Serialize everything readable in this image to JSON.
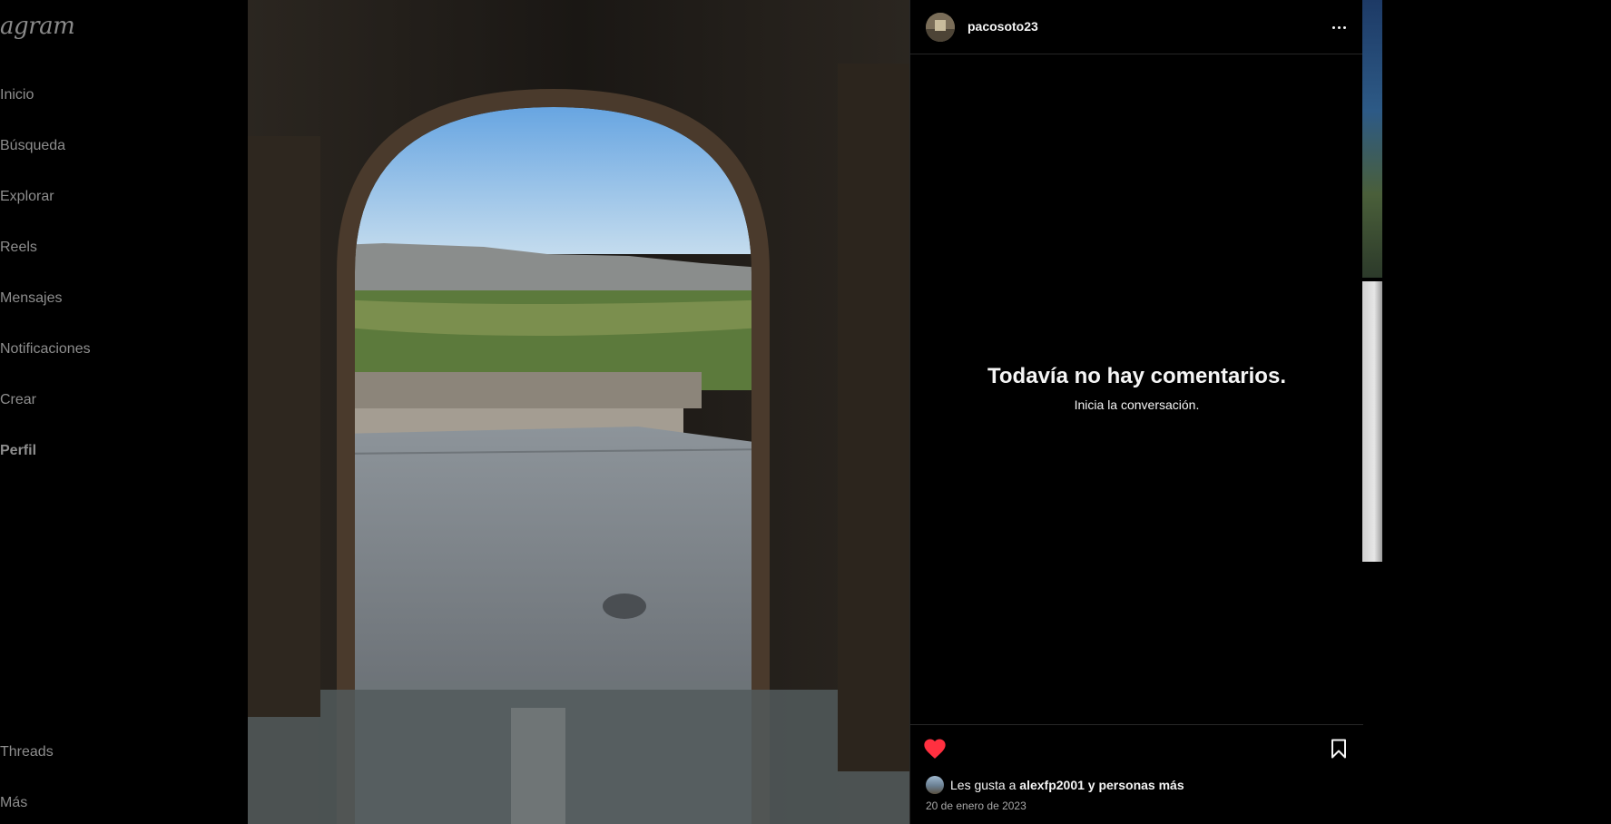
{
  "sidebar": {
    "logo": "agram",
    "items": [
      {
        "label": "Inicio"
      },
      {
        "label": "Búsqueda"
      },
      {
        "label": "Explorar"
      },
      {
        "label": "Reels"
      },
      {
        "label": "Mensajes"
      },
      {
        "label": "Notificaciones"
      },
      {
        "label": "Crear"
      },
      {
        "label": "Perfil"
      }
    ],
    "bottom_items": [
      {
        "label": "Threads"
      },
      {
        "label": "Más"
      }
    ]
  },
  "post": {
    "username": "pacosoto23",
    "empty_title": "Todavía no hay comentarios.",
    "empty_subtitle": "Inicia la conversación.",
    "likes_prefix": "Les gusta a ",
    "likes_user": "alexfp2001",
    "likes_suffix": " y personas más",
    "date": "20 de enero de 2023",
    "liked": true
  },
  "colors": {
    "like_red": "#ff3040",
    "background": "#000000",
    "divider": "#262626"
  },
  "icons": {
    "more": "more-options-icon",
    "like": "heart-filled-icon",
    "save": "bookmark-icon"
  }
}
